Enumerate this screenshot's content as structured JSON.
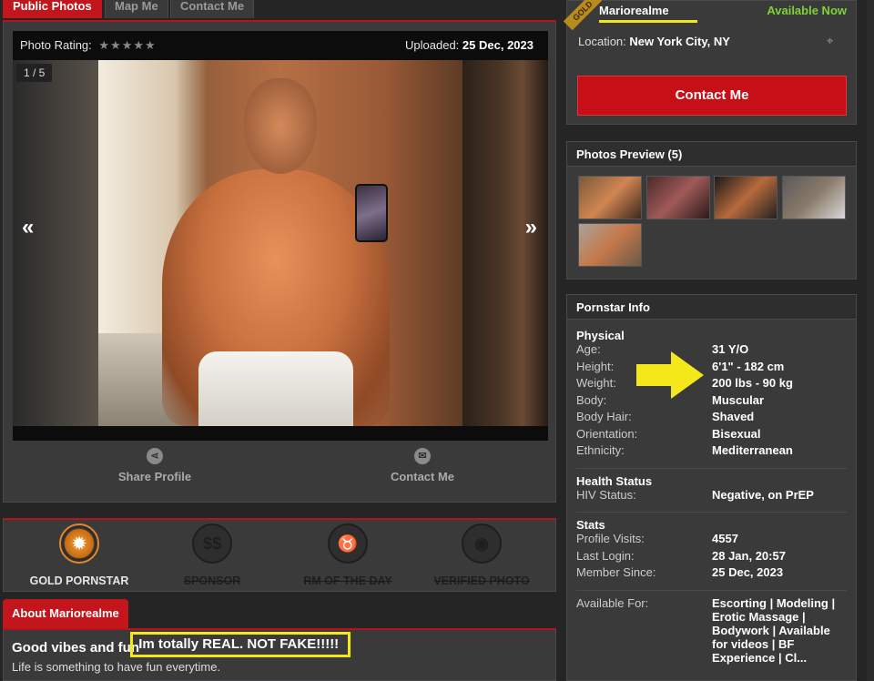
{
  "tabs": [
    "Public Photos",
    "Map Me",
    "Contact Me"
  ],
  "gallery": {
    "rating_label": "Photo Rating:",
    "stars": "★★★★★",
    "uploaded_label": "Uploaded:",
    "uploaded_date": "25 Dec, 2023",
    "counter": "1 / 5",
    "prev_arrow": "«",
    "next_arrow": "»",
    "share_label": "Share Profile",
    "contact_label": "Contact Me"
  },
  "badges": [
    {
      "label": "GOLD PORNSTAR",
      "icon": "award-icon",
      "active": true
    },
    {
      "label": "SPONSOR",
      "icon": "dollar-icon",
      "active": false
    },
    {
      "label": "RM OF THE DAY",
      "icon": "taurus-icon",
      "active": false
    },
    {
      "label": "VERIFIED PHOTO",
      "icon": "camera-icon",
      "active": false
    }
  ],
  "badge_glyphs": [
    "✹",
    "$$",
    "♉",
    "◉"
  ],
  "about": {
    "tab": "About Mariorealme",
    "title_prefix": "Good vibes and fun",
    "title_highlight": "Im totally REAL. NOT FAKE!!!!!",
    "text": "Life is something to have fun everytime."
  },
  "profile": {
    "ribbon": "GOLD",
    "username": "Mariorealme",
    "status": "Available Now",
    "location_label": "Location:",
    "location": "New York City, NY",
    "contact_button": "Contact Me"
  },
  "photos_preview": {
    "title": "Photos Preview (5)"
  },
  "info": {
    "title": "Pornstar Info",
    "physical_title": "Physical",
    "physical": [
      {
        "k": "Age:",
        "v": "31 Y/O"
      },
      {
        "k": "Height:",
        "v": "6'1\" - 182 cm"
      },
      {
        "k": "Weight:",
        "v": "200 lbs - 90 kg"
      },
      {
        "k": "Body:",
        "v": "Muscular"
      },
      {
        "k": "Body Hair:",
        "v": "Shaved"
      },
      {
        "k": "Orientation:",
        "v": "Bisexual"
      },
      {
        "k": "Ethnicity:",
        "v": "Mediterranean"
      }
    ],
    "health_title": "Health Status",
    "health": [
      {
        "k": "HIV Status:",
        "v": "Negative, on PrEP"
      }
    ],
    "stats_title": "Stats",
    "stats": [
      {
        "k": "Profile Visits:",
        "v": "4557"
      },
      {
        "k": "Last Login:",
        "v": "28 Jan, 20:57"
      },
      {
        "k": "Member Since:",
        "v": "25 Dec, 2023"
      }
    ],
    "available_label": "Available For:",
    "available_value": "Escorting | Modeling | Erotic Massage | Bodywork | Available for videos | BF Experience | Cl..."
  },
  "colors": {
    "accent_red": "#c2151c",
    "available_green": "#7dd33a",
    "highlight_yellow": "#f4e81b",
    "gold": "#e3872b"
  }
}
